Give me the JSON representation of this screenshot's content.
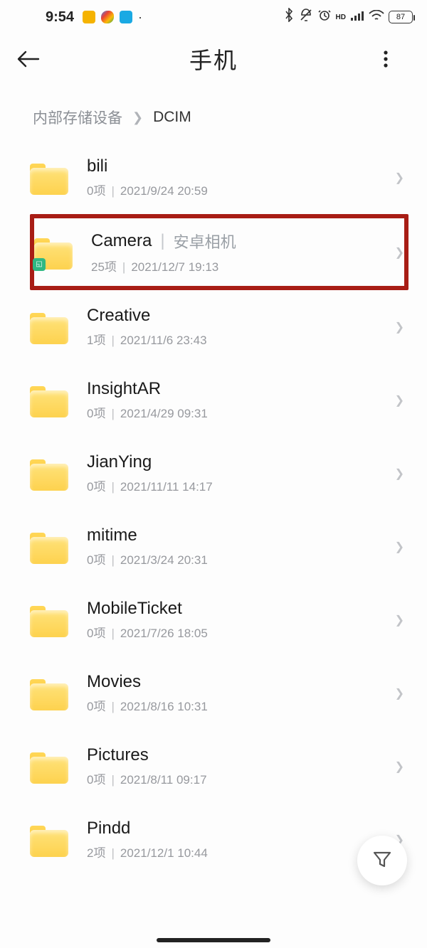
{
  "status": {
    "time": "9:54",
    "battery": "87"
  },
  "header": {
    "title": "手机"
  },
  "breadcrumb": {
    "root": "内部存储设备",
    "current": "DCIM"
  },
  "folders": [
    {
      "name": "bili",
      "tag": "",
      "count": "0项",
      "date": "2021/9/24 20:59",
      "badge": false
    },
    {
      "name": "Camera",
      "tag": "安卓相机",
      "count": "25项",
      "date": "2021/12/7 19:13",
      "badge": true
    },
    {
      "name": "Creative",
      "tag": "",
      "count": "1项",
      "date": "2021/11/6 23:43",
      "badge": false
    },
    {
      "name": "InsightAR",
      "tag": "",
      "count": "0项",
      "date": "2021/4/29 09:31",
      "badge": false
    },
    {
      "name": "JianYing",
      "tag": "",
      "count": "0项",
      "date": "2021/11/11 14:17",
      "badge": false
    },
    {
      "name": "mitime",
      "tag": "",
      "count": "0项",
      "date": "2021/3/24 20:31",
      "badge": false
    },
    {
      "name": "MobileTicket",
      "tag": "",
      "count": "0项",
      "date": "2021/7/26 18:05",
      "badge": false
    },
    {
      "name": "Movies",
      "tag": "",
      "count": "0项",
      "date": "2021/8/16 10:31",
      "badge": false
    },
    {
      "name": "Pictures",
      "tag": "",
      "count": "0项",
      "date": "2021/8/11 09:17",
      "badge": false
    },
    {
      "name": "Pindd",
      "tag": "",
      "count": "2项",
      "date": "2021/12/1 10:44",
      "badge": false
    }
  ]
}
